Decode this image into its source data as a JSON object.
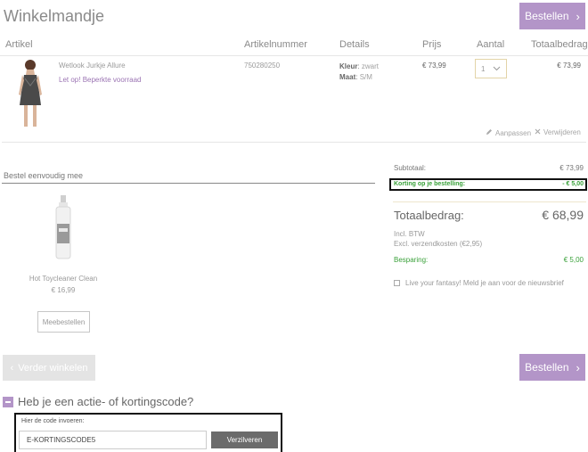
{
  "header": {
    "title": "Winkelmandje",
    "order_label": "Bestellen"
  },
  "table": {
    "columns": [
      "Artikel",
      "Artikelnummer",
      "Details",
      "Prijs",
      "Aantal",
      "Totaalbedrag"
    ]
  },
  "cart_item": {
    "name": "Wetlook Jurkje Allure",
    "stock_note": "Let op! Beperkte voorraad",
    "article_number": "750280250",
    "color_label": "Kleur",
    "color_value": "zwart",
    "size_label": "Maat",
    "size_value": "S/M",
    "price": "€ 73,99",
    "quantity": "1",
    "total": "€ 73,99",
    "edit_label": "Aanpassen",
    "remove_label": "Verwijderen"
  },
  "upsell": {
    "section_title": "Bestel eenvoudig mee",
    "product_name": "Hot Toycleaner Clean",
    "product_price": "€ 16,99",
    "button_label": "Meebestellen"
  },
  "summary": {
    "subtotal_label": "Subtotaal:",
    "subtotal_value": "€ 73,99",
    "discount_label": "Korting op je bestelling:",
    "discount_value": "- € 5,00",
    "total_label": "Totaalbedrag:",
    "total_value": "€ 68,99",
    "vat_note": "Incl. BTW",
    "shipping_note": "Excl. verzendkosten (€2,95)",
    "savings_label": "Besparing:",
    "savings_value": "€ 5,00",
    "newsletter_label": "Live your fantasy! Meld je aan voor de nieuwsbrief"
  },
  "footer": {
    "continue_label": "Verder winkelen",
    "order_label": "Bestellen"
  },
  "coupon": {
    "title": "Heb je een actie- of kortingscode?",
    "field_label": "Hier de code invoeren:",
    "code_value": "E-KORTINGSCODE5",
    "redeem_label": "Verzilveren"
  },
  "colors": {
    "accent_purple": "#b395c8",
    "discount_green": "#3aa13a",
    "redeem_grey": "#6b6b6b"
  }
}
